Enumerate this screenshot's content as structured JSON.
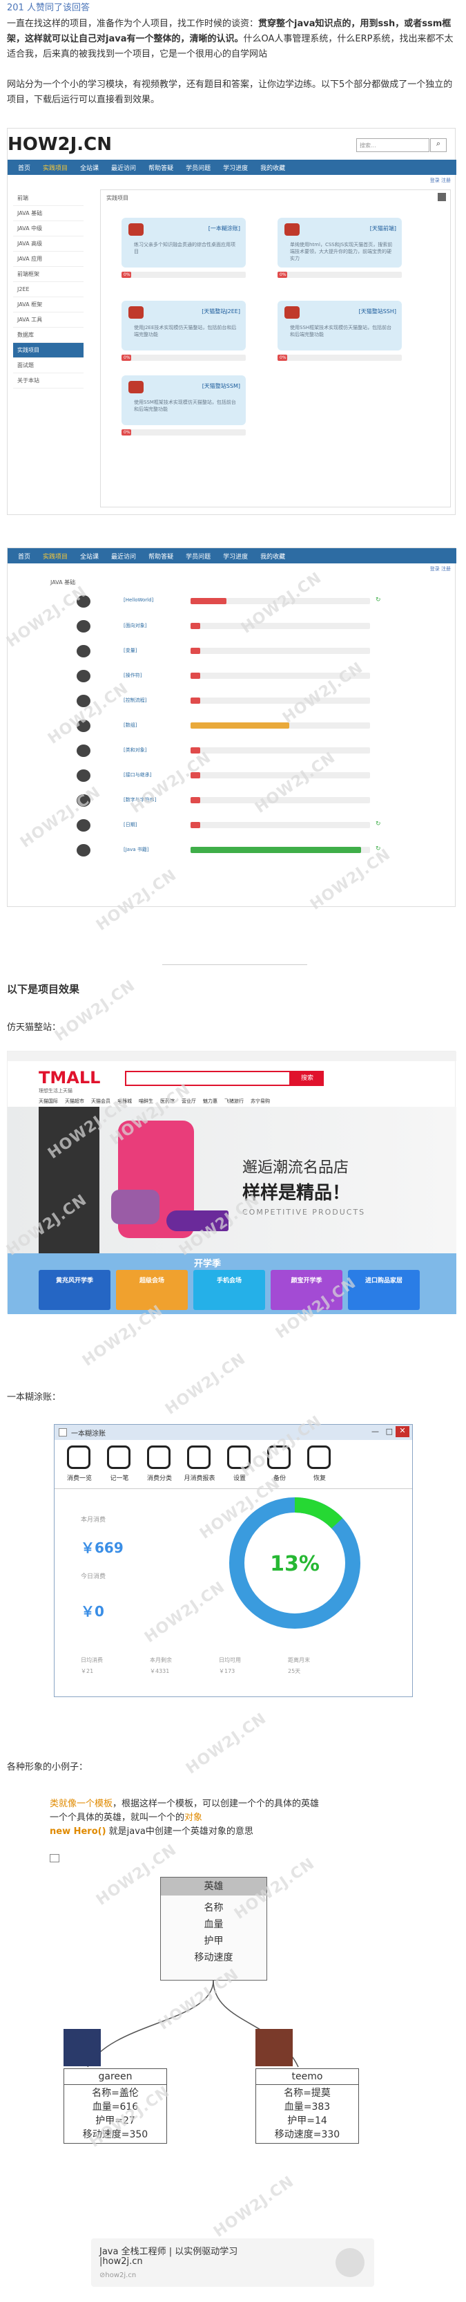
{
  "top_link": "201 人赞同了该回答",
  "para1_a": "一直在找这样的项目，准备作为个人项目，找工作时候的谈资：",
  "para1_b": "贯穿整个java知识点的，用到ssh，或者ssm框架，这样就可以让自己对java有一个整体的，清晰的认识。",
  "para1_c": "什么OA人事管理系统，什么ERP系统，找出来都不太适合我，后来真的被我找到一个项目，它是一个很用心的自学网站",
  "para2": "网站分为一个个小的学习模块，有视频教学，还有题目和答案，让你边学边练。以下5个部分都做成了一个独立的项目，下载后运行可以直接看到效果。",
  "site": {
    "logo": "HOW2J.CN",
    "search_placeholder": "搜索...",
    "nav": [
      "首页",
      "实践项目",
      "全站课",
      "最近访问",
      "帮助答疑",
      "学员问题",
      "学习进度",
      "我的收藏"
    ],
    "login": "登录 注册 ",
    "side_items": [
      "前端",
      "JAVA 基础",
      "JAVA 中级",
      "JAVA 高级",
      "JAVA 应用",
      "前端框架",
      "J2EE",
      "JAVA 框架",
      "JAVA 工具",
      "数据库",
      "实践项目",
      "面试题",
      "关于本站"
    ],
    "panel_title": "实践项目",
    "cards": [
      {
        "tag": "[一本糊涂账]",
        "txt": "练习父亲多个知识融会贯通的综合性桌面应用项目"
      },
      {
        "tag": "[天猫前端]",
        "txt": "单纯使用html，CSS和JS实现天猫首页，搜索前端技术要领，大大提升你的能力，前端宝贵的硬实力"
      },
      {
        "tag": "[天猫整站J2EE]",
        "txt": "使用J2EE技术实现模仿天猫整站，包括前台和后端完整功能"
      },
      {
        "tag": "[天猫整站SSH]",
        "txt": "使用SSH框架技术实现模仿天猫整站，包括前台和后端完整功能"
      },
      {
        "tag": "[天猫整站SSM]",
        "txt": "使用SSM框架技术实现模仿天猫整站，包括前台和后端完整功能"
      }
    ],
    "pct": "0%",
    "java_title": "JAVA 基础",
    "lessons": [
      "[HelloWorld]",
      "[面向对象]",
      "[变量]",
      "[操作符]",
      "[控制流程]",
      "[数组]",
      "[类和对象]",
      "[接口与继承]",
      "[数字与字符串]",
      "[日期]",
      "[Java 书籍]"
    ]
  },
  "watermark": "HOW2J.CN",
  "section_title": "以下是项目效果",
  "label_tmall": "仿天猫整站：",
  "tmall": {
    "logo": "TMALL",
    "sub": "理想生活上天猫",
    "search_btn": "搜索",
    "hero1": "邂逅潮流名品店",
    "hero2": "样样是精品！",
    "hero3": "COMPETITIVE PRODUCTS",
    "tabs": [
      "天猫国际",
      "天猫超市",
      "天猫会员",
      "电器城",
      "喵鲜生",
      "医药馆",
      "营业厅",
      "魅力惠",
      "飞猪旅行",
      "苏宁易购"
    ],
    "promo": "开学季",
    "tiles": [
      "黄兆风开学季",
      "超级会场",
      "手机会场",
      "颜宝开学季",
      "进口购品家居"
    ]
  },
  "label_ledger": "一本糊涂账：",
  "ledger": {
    "title": "一本糊涂账",
    "tools": [
      "消费一览",
      "记一笔",
      "消费分类",
      "月消费报表",
      "设置",
      "备份",
      "恢复"
    ],
    "month_label": "本月消费",
    "month_val": "￥669",
    "today_label": "今日消费",
    "today_val": "￥0",
    "pct": "13%",
    "stats": [
      [
        "日均消费",
        "￥21"
      ],
      [
        "本月剩余",
        "￥4331"
      ],
      [
        "日均可用",
        "￥173"
      ],
      [
        "距离月末",
        "25天"
      ]
    ]
  },
  "label_small": "各种形象的小例子：",
  "hero": {
    "l1a": "类就像一个模板",
    "l1b": "，根据这样一个模板，可以创建一个个的具体的英雄",
    "l2": "一个个具体的英雄，就叫一个个的",
    "l2b": "对象",
    "l3a": "new Hero()",
    "l3b": " 就是java中创建一个英雄对象的意思",
    "cls": "英雄",
    "fields": [
      "名称",
      "血量",
      "护甲",
      "移动速度"
    ],
    "a_name": "gareen",
    "a_fields": [
      "名称=盖伦",
      "血量=616",
      "护甲=27",
      "移动速度=350"
    ],
    "b_name": "teemo",
    "b_fields": [
      "名称=提莫",
      "血量=383",
      "护甲=14",
      "移动速度=330"
    ]
  },
  "footer": {
    "t1": "Java 全栈工程师 | 以实例驱动学习",
    "t2": "|how2j.cn",
    "t3": "how2j.cn"
  }
}
